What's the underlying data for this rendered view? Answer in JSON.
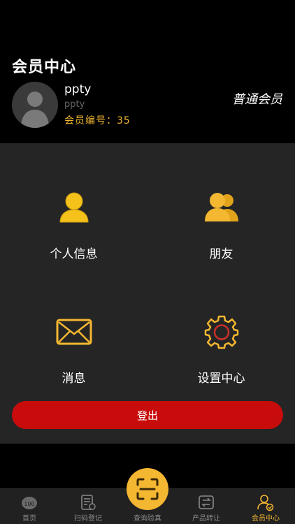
{
  "header": {
    "title": "会员中心",
    "user": {
      "name": "ppty",
      "nickname": "ppty",
      "member_no_label": "会员编号：",
      "member_no": "35",
      "level": "普通会员"
    }
  },
  "menu": [
    {
      "label": "个人信息",
      "icon": "person-icon"
    },
    {
      "label": "朋友",
      "icon": "friends-icon"
    },
    {
      "label": "消息",
      "icon": "envelope-icon"
    },
    {
      "label": "设置中心",
      "icon": "gear-icon"
    }
  ],
  "logout_label": "登出",
  "tabbar": {
    "items": [
      {
        "label": "首页",
        "icon": "home-icon"
      },
      {
        "label": "扫码登记",
        "icon": "scan-register-icon"
      },
      {
        "label": "查询验真",
        "icon": "scan-icon"
      },
      {
        "label": "产品转让",
        "icon": "transfer-icon"
      },
      {
        "label": "会员中心",
        "icon": "member-icon"
      }
    ],
    "active": "会员中心"
  },
  "colors": {
    "accent": "#f4b731",
    "logout": "#c80c0c",
    "panel": "#252525",
    "background": "#000000"
  }
}
